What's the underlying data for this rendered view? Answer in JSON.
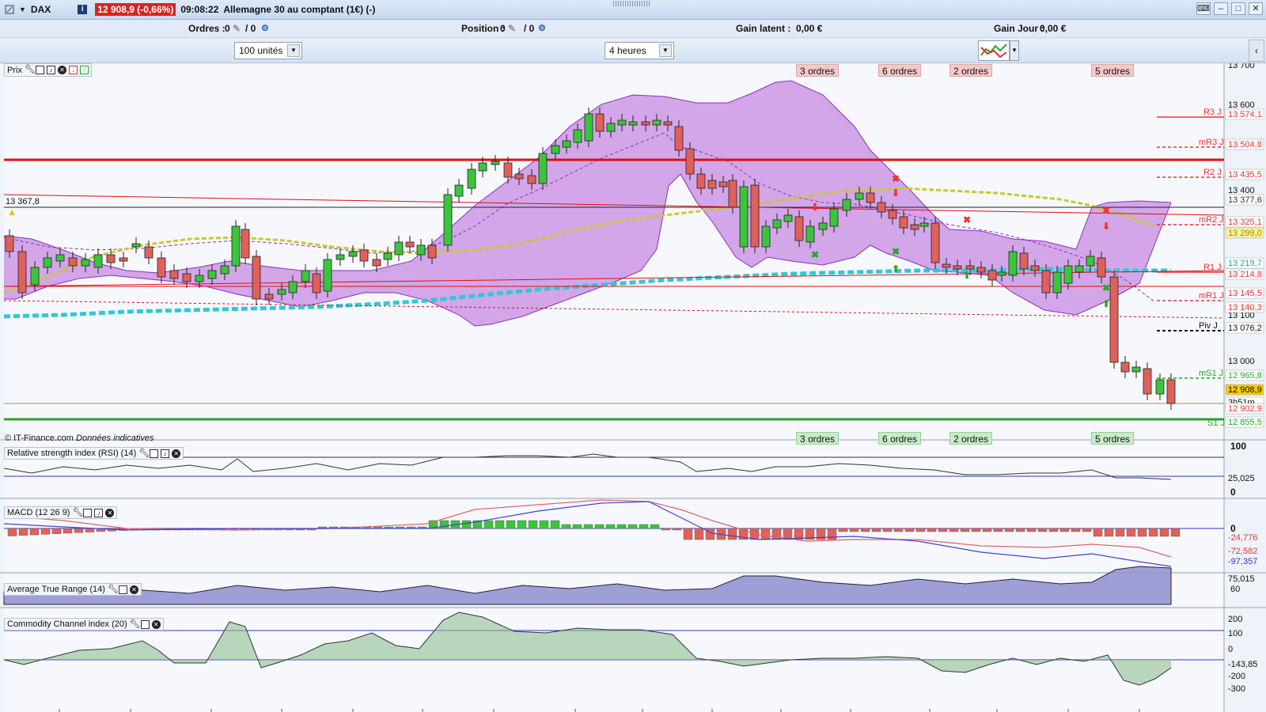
{
  "titlebar": {
    "symbol": "DAX",
    "price_badge": "12 908,9 (-0,66%)",
    "time": "09:08:22",
    "title": "Allemagne 30 au comptant (1€) (-)",
    "info_icon": "i"
  },
  "infobar": {
    "orders_label": "Ordres :",
    "orders_value": "0",
    "orders_slash": "/ 0",
    "position_label": "Position :",
    "position_value": "0",
    "position_slash": "/ 0",
    "gain_latent_label": "Gain latent :",
    "gain_latent_value": "0,00 €",
    "gain_jour_label": "Gain Jour :",
    "gain_jour_value": "0,00 €"
  },
  "toolbar": {
    "units_select": "100 unités",
    "period_select": "4 heures"
  },
  "price_panel": {
    "label": "Prix",
    "ref_level": "13 367,8",
    "copyright": "© IT-Finance.com",
    "data_note": "Données indicatives",
    "orders_tags": [
      "3 ordres",
      "6 ordres",
      "2 ordres",
      "5 ordres"
    ],
    "axis_ticks": [
      "13 700",
      "13 600",
      "13 400",
      "13 100",
      "13 000"
    ],
    "pivot_labels": [
      "R3 J",
      "mR3 J",
      "R2 J",
      "mR2 J",
      "R1 J",
      "mR1 J",
      "Piv J",
      "mS1 J",
      "S1 J"
    ],
    "pivot_values": [
      "13 574,1",
      "13 504,8",
      "13 435,5",
      "13 377,6",
      "13 325,1",
      "13 299,0",
      "13 219,7",
      "13 214,8",
      "13 145,5",
      "13 140,3",
      "13 076,2",
      "12 965,8",
      "12 908,9",
      "3h51m",
      "12 902,9",
      "12 855,5"
    ]
  },
  "rsi_panel": {
    "label": "Relative strength index (RSI) (14)",
    "axis_top": "100",
    "axis_bottom": "0",
    "value": "25,025"
  },
  "macd_panel": {
    "label": "MACD (12 26 9)",
    "axis_zero": "0",
    "value1": "-24,776",
    "value2": "-72,582",
    "value3": "-97,357"
  },
  "atr_panel": {
    "label": "Average True Range (14)",
    "value": "75,015",
    "axis_tick": "60"
  },
  "cci_panel": {
    "label": "Commodity Channel index (20)",
    "axis_ticks": [
      "200",
      "100",
      "0",
      "-200",
      "-300"
    ],
    "value": "-143,85"
  },
  "colors": {
    "bullish": "#3cc43c",
    "bearish": "#e0605a",
    "bollinger_fill": "#c68be0",
    "bollinger_line": "#8a2fbf",
    "ma_yellow": "#c9c92a",
    "ma_cyan": "#30c8d8",
    "resistance": "#e01010",
    "support": "#30a030"
  }
}
